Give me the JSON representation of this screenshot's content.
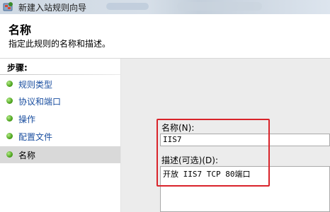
{
  "window": {
    "title": "新建入站规则向导"
  },
  "header": {
    "title": "名称",
    "subtitle": "指定此规则的名称和描述。"
  },
  "steps": {
    "header": "步骤:",
    "items": [
      {
        "label": "规则类型",
        "active": false
      },
      {
        "label": "协议和端口",
        "active": false
      },
      {
        "label": "操作",
        "active": false
      },
      {
        "label": "配置文件",
        "active": false
      },
      {
        "label": "名称",
        "active": true
      }
    ]
  },
  "form": {
    "name_label": "名称(N):",
    "name_value": "IIS7",
    "desc_label": "描述(可选)(D):",
    "desc_value": "开放 IIS7 TCP 80端口"
  },
  "colors": {
    "highlight": "#d9232a",
    "step_link": "#1b4fa0"
  }
}
